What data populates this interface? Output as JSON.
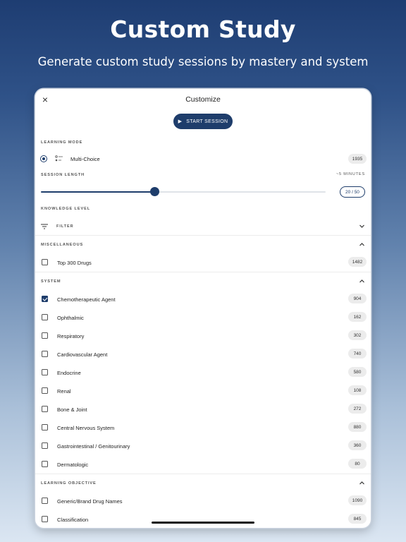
{
  "hero": {
    "title": "Custom Study",
    "subtitle": "Generate custom study sessions by mastery and system"
  },
  "topbar": {
    "close_icon": "×",
    "title": "Customize"
  },
  "start_button": {
    "icon": "▶",
    "label": "START SESSION"
  },
  "learning_mode": {
    "label": "LEARNING MODE",
    "option": "Multi-Choice",
    "count": "1935"
  },
  "session_length": {
    "label": "SESSION LENGTH",
    "estimate": "~5 MINUTES",
    "value": "20 / 50",
    "current": 20,
    "max": 50
  },
  "knowledge_level": {
    "label": "KNOWLEDGE LEVEL",
    "filter_label": "FILTER"
  },
  "miscellaneous": {
    "label": "MISCELLANEOUS",
    "items": [
      {
        "label": "Top 300 Drugs",
        "count": "1482",
        "checked": false
      }
    ]
  },
  "system": {
    "label": "SYSTEM",
    "items": [
      {
        "label": "Chemotherapeutic Agent",
        "count": "904",
        "checked": true
      },
      {
        "label": "Ophthalmic",
        "count": "162",
        "checked": false
      },
      {
        "label": "Respiratory",
        "count": "302",
        "checked": false
      },
      {
        "label": "Cardiovascular Agent",
        "count": "740",
        "checked": false
      },
      {
        "label": "Endocrine",
        "count": "580",
        "checked": false
      },
      {
        "label": "Renal",
        "count": "108",
        "checked": false
      },
      {
        "label": "Bone & Joint",
        "count": "272",
        "checked": false
      },
      {
        "label": "Central Nervous System",
        "count": "880",
        "checked": false
      },
      {
        "label": "Gastrointestinal / Genitourinary",
        "count": "360",
        "checked": false
      },
      {
        "label": "Dermatologic",
        "count": "80",
        "checked": false
      }
    ]
  },
  "learning_objective": {
    "label": "LEARNING OBJECTIVE",
    "items": [
      {
        "label": "Generic/Brand Drug Names",
        "count": "1090",
        "checked": false
      },
      {
        "label": "Classification",
        "count": "845",
        "checked": false
      }
    ]
  },
  "colors": {
    "accent": "#1e3d6b",
    "badge_bg": "#ececec"
  }
}
